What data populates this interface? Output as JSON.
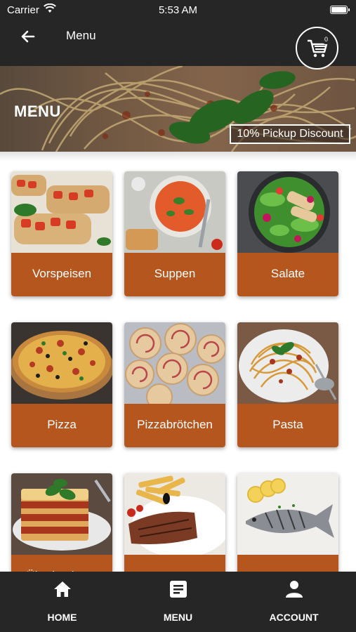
{
  "status_bar": {
    "carrier": "Carrier",
    "time": "5:53 AM"
  },
  "header": {
    "title": "Menu",
    "cart_count": "0"
  },
  "hero": {
    "heading": "MENU",
    "discount": "10% Pickup Discount"
  },
  "categories": [
    {
      "label": "Vorspeisen"
    },
    {
      "label": "Suppen"
    },
    {
      "label": "Salate"
    },
    {
      "label": "Pizza"
    },
    {
      "label": "Pizzabrötchen"
    },
    {
      "label": "Pasta"
    },
    {
      "label": "Überbackene"
    },
    {
      "label": ""
    },
    {
      "label": ""
    }
  ],
  "tabs": [
    {
      "label": "HOME",
      "icon": "home-icon"
    },
    {
      "label": "MENU",
      "icon": "menu-list-icon"
    },
    {
      "label": "ACCOUNT",
      "icon": "account-icon"
    }
  ],
  "colors": {
    "bar": "#262626",
    "accent": "#b5561e"
  }
}
